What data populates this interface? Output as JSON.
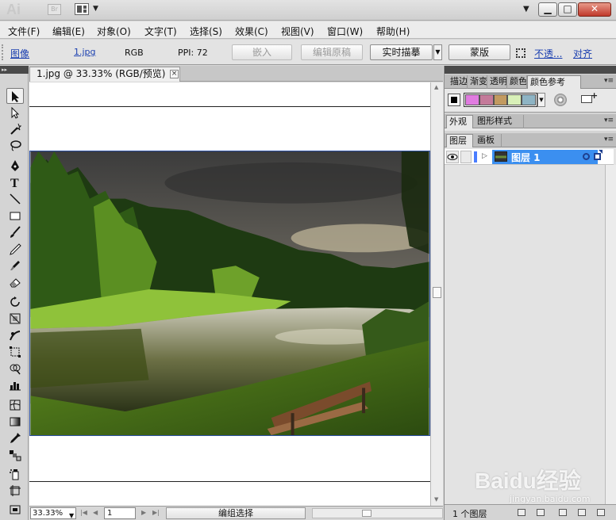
{
  "titlebar": {
    "logo": "Ai",
    "bridge": "Br",
    "minimize": "▁",
    "maximize": "□",
    "close": "✕"
  },
  "menu": [
    {
      "label": "文件(F)"
    },
    {
      "label": "编辑(E)"
    },
    {
      "label": "对象(O)"
    },
    {
      "label": "文字(T)"
    },
    {
      "label": "选择(S)"
    },
    {
      "label": "效果(C)"
    },
    {
      "label": "视图(V)"
    },
    {
      "label": "窗口(W)"
    },
    {
      "label": "帮助(H)"
    }
  ],
  "control": {
    "object_type": "图像",
    "file_name": "1.jpg",
    "color_mode": "RGB",
    "ppi": "PPI: 72",
    "embed_label": "嵌入",
    "edit_original_label": "编辑原稿",
    "live_trace_label": "实时描摹",
    "mask_label": "蒙版",
    "opacity_link": "不透...",
    "align_link": "对齐"
  },
  "document": {
    "tab_title": "1.jpg @ 33.33% (RGB/预览)",
    "tab_close": "×"
  },
  "status": {
    "zoom": "33.33%",
    "page": "1",
    "tool_status": "编组选择"
  },
  "panels": {
    "top_tabs": [
      "描边",
      "渐变",
      "透明",
      "颜色",
      "颜色参考"
    ],
    "mid_tabs": [
      "外观",
      "图形样式"
    ],
    "layer_tabs": [
      "图层",
      "画板"
    ],
    "layer_name": "图层 1",
    "layer_count": "1 个图层"
  },
  "swatches": {
    "colors": [
      "#e07be0",
      "#c47a9a",
      "#c29a60",
      "#d8f0b8",
      "#8eb4c4"
    ]
  },
  "watermark": {
    "brand": "Baidu经验",
    "url": "jingyan.baidu.com"
  }
}
